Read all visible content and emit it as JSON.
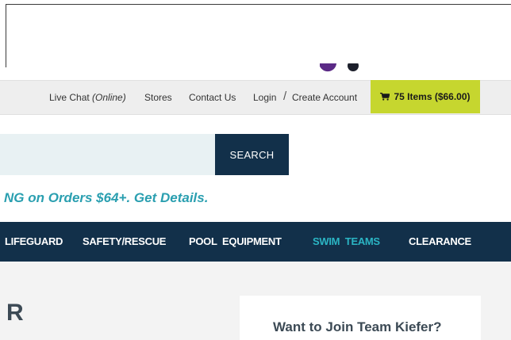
{
  "utility_bar": {
    "live_chat_label": "Live Chat",
    "live_chat_status": "(Online)",
    "stores_label": "Stores",
    "contact_label": "Contact Us",
    "login_label": "Login",
    "separator": "/",
    "create_account_label": "Create Account"
  },
  "cart": {
    "label": "75 Items ($66.00)",
    "icon": "cart-icon",
    "color": "#c6d62f"
  },
  "search": {
    "button_label": "SEARCH",
    "value": ""
  },
  "promo": {
    "text": "NG on Orders $64+. Get Details."
  },
  "nav": {
    "items": [
      {
        "label": "LIFEGUARD",
        "active": false
      },
      {
        "label": "SAFETY/RESCUE",
        "active": false
      },
      {
        "label": "POOL  EQUIPMENT",
        "active": false
      },
      {
        "label": "SWIM  TEAMS",
        "active": true
      },
      {
        "label": "CLEARANCE",
        "active": false
      }
    ]
  },
  "main": {
    "heading_fragment": "R",
    "card_title": "Want to Join Team Kiefer?"
  },
  "colors": {
    "navy": "#12304a",
    "teal": "#2a9fb0",
    "accent": "#c6d62f"
  }
}
